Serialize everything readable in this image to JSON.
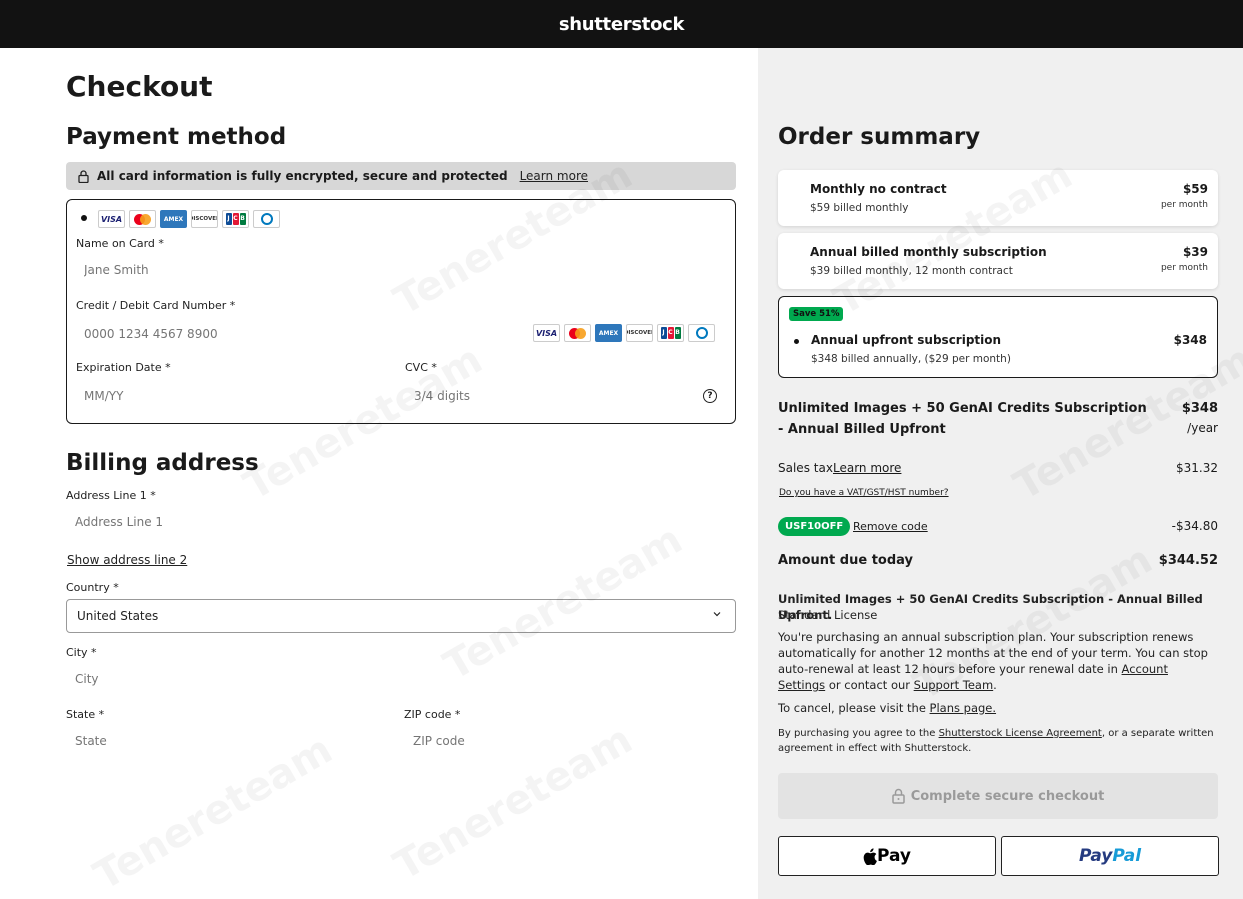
{
  "header": {
    "logo": "shutterstock"
  },
  "checkout": {
    "title": "Checkout",
    "payment_title": "Payment method",
    "secure_text": "All card information is fully encrypted, secure and protected",
    "secure_link": "Learn more",
    "card_brands": [
      "VISA",
      "Mastercard",
      "AMEX",
      "DISCOVER",
      "JCB",
      "Diners"
    ],
    "name_label": "Name on Card *",
    "name_placeholder": "Jane Smith",
    "card_label": "Credit / Debit Card Number *",
    "card_placeholder": "0000 1234 4567 8900",
    "exp_label": "Expiration Date *",
    "exp_placeholder": "MM/YY",
    "cvc_label": "CVC *",
    "cvc_placeholder": "3/4 digits",
    "help_glyph": "?"
  },
  "billing": {
    "title": "Billing address",
    "addr1_label": "Address Line 1 *",
    "addr1_placeholder": "Address Line 1",
    "show_addr2": "Show address line 2",
    "country_label": "Country *",
    "country_value": "United States",
    "city_label": "City *",
    "city_placeholder": "City",
    "state_label": "State *",
    "state_placeholder": "State",
    "zip_label": "ZIP code *",
    "zip_placeholder": "ZIP code"
  },
  "summary": {
    "title": "Order summary",
    "plans": [
      {
        "name": "Monthly no contract",
        "sub": "$59 billed monthly",
        "price": "$59",
        "per": "per month"
      },
      {
        "name": "Annual billed monthly subscription",
        "sub": "$39 billed monthly, 12 month contract",
        "price": "$39",
        "per": "per month"
      },
      {
        "badge": "Save 51%",
        "name": "Annual upfront subscription",
        "sub": "$348 billed annually, ($29 per month)",
        "price": "$348"
      }
    ],
    "product_line1": "Unlimited Images + 50 GenAI Credits Subscription",
    "product_line2": "- Annual Billed Upfront",
    "product_price": "$348",
    "product_per": "/year",
    "tax_label": "Sales tax",
    "tax_link": "Learn more",
    "tax_value": "$31.32",
    "vat_link": "Do you have a VAT/GST/HST number?",
    "coupon_code": "USF10OFF",
    "remove_code": "Remove code",
    "discount": "-$34.80",
    "due_label": "Amount due today",
    "due_value": "$344.52",
    "desc_title": "Unlimited Images + 50 GenAI Credits Subscription - Annual Billed Upfront.",
    "desc_license": "Standard License",
    "desc_body": "You're purchasing an annual subscription plan. Your subscription renews automatically for another 12 months at the end of your term. You can stop auto-renewal at least 12 hours before your renewal date in",
    "desc_account_link": "Account Settings",
    "desc_or": "or contact our",
    "desc_support_link": "Support Team",
    "desc_period": ".",
    "cancel_text": "To cancel, please visit the",
    "cancel_link": "Plans page.",
    "agree_pre": "By purchasing you agree to the",
    "agree_link": "Shutterstock License Agreement",
    "agree_post": ", or a separate written agreement in effect with Shutterstock.",
    "checkout_button": "Complete secure checkout",
    "applepay_label": "Pay",
    "paypal_pay": "Pay",
    "paypal_pal": "Pal"
  },
  "watermark": "Tenereteam"
}
